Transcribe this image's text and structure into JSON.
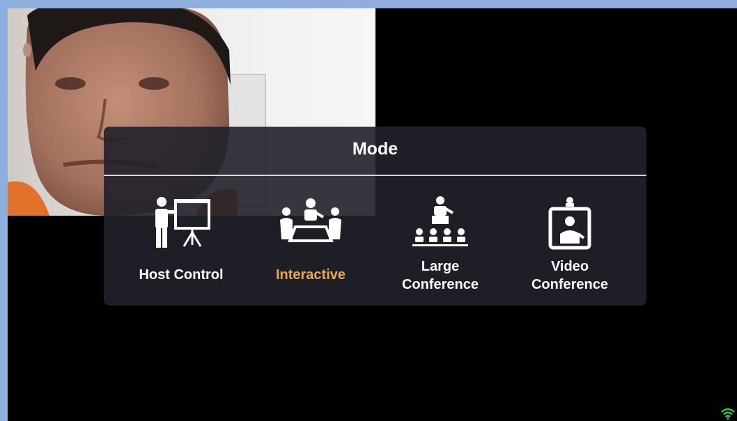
{
  "colors": {
    "frame_border": "#8eaede",
    "screen_background": "#000000",
    "panel_background": "#20212a",
    "text": "#ffffff",
    "active_accent": "#e9a94a",
    "wifi": "#35c759"
  },
  "panel": {
    "title": "Mode"
  },
  "modes": [
    {
      "label_line1": "Host Control",
      "label_line2": "",
      "icon": "presenter-board-icon",
      "active": false
    },
    {
      "label_line1": "Interactive",
      "label_line2": "",
      "icon": "meeting-table-icon",
      "active": true
    },
    {
      "label_line1": "Large",
      "label_line2": "Conference",
      "icon": "audience-icon",
      "active": false
    },
    {
      "label_line1": "Video",
      "label_line2": "Conference",
      "icon": "video-screen-icon",
      "active": false
    }
  ],
  "status": {
    "wifi_icon": "wifi-icon"
  }
}
